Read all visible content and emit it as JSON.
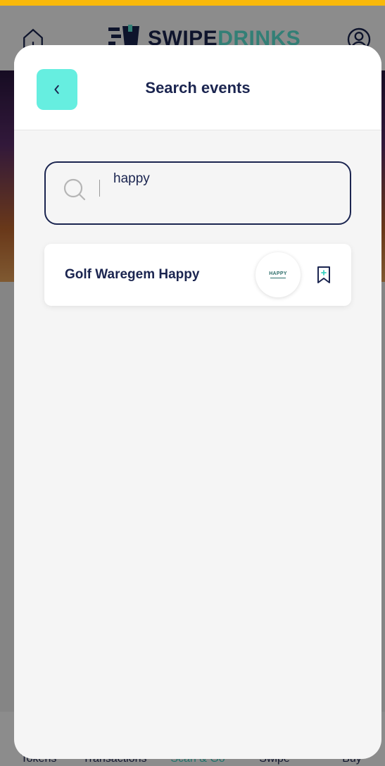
{
  "app": {
    "brand_part1": "SWIPE",
    "brand_part2": "DRINKS",
    "tabs": [
      "Tokens",
      "Transactions",
      "Scan & Go",
      "Swipe",
      "Buy"
    ],
    "colors": {
      "accent": "#66eee0",
      "navy": "#1b2550",
      "stripe": "#f9b90a"
    }
  },
  "modal": {
    "title": "Search events",
    "back_icon": "chevron-left-icon"
  },
  "search": {
    "value": "happy",
    "icon": "search-icon"
  },
  "results": [
    {
      "name": "Golf Waregem Happy",
      "logo_text": "HAPPY",
      "bookmark_icon": "bookmark-plus-icon"
    }
  ]
}
